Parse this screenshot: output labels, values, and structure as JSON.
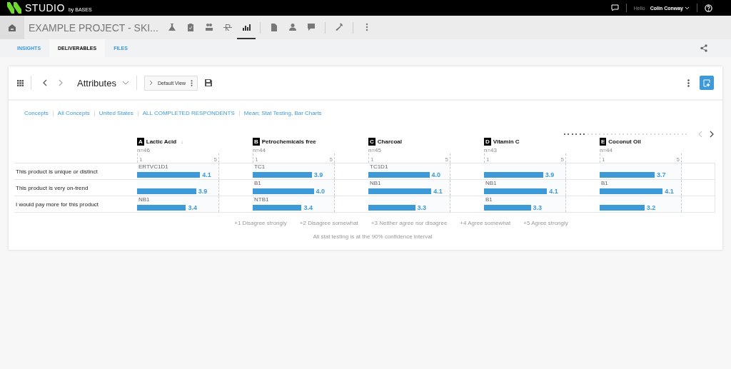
{
  "top_bar": {
    "brand": "STUDIO",
    "brand_suffix": "by BASES",
    "greeting": "Hello",
    "user": "Colin Conway"
  },
  "project": {
    "title": "EXAMPLE PROJECT - SKI...",
    "nav_groups": [
      {
        "icons": [
          {
            "kind": "lab",
            "selected": false
          },
          {
            "kind": "clipboard",
            "selected": false
          },
          {
            "kind": "people",
            "selected": false
          },
          {
            "kind": "r",
            "selected": false
          },
          {
            "kind": "chart",
            "selected": true
          }
        ]
      },
      {
        "icons": [
          {
            "kind": "document",
            "selected": false
          },
          {
            "kind": "person",
            "selected": false
          },
          {
            "kind": "comment",
            "selected": false
          }
        ]
      },
      {
        "icons": [
          {
            "kind": "wrench",
            "selected": false
          }
        ]
      },
      {
        "icons": [
          {
            "kind": "kebab",
            "selected": false
          }
        ]
      }
    ]
  },
  "tabs": [
    {
      "label": "INSIGHTS",
      "selected": false
    },
    {
      "label": "DELIVERABLES",
      "selected": true
    },
    {
      "label": "FILES",
      "selected": false
    }
  ],
  "toolbar": {
    "title": "Attributes",
    "view": "Default View"
  },
  "filters": [
    "Concepts",
    "All Concepts",
    "United States",
    "ALL COMPLETED RESPONDENTS",
    "Mean; Stat Testing, Bar Charts"
  ],
  "pager": [
    {
      "selected": true
    },
    {
      "selected": true
    },
    {
      "selected": true
    },
    {
      "selected": true
    },
    {
      "selected": true
    },
    {
      "selected": true
    },
    {
      "selected": false
    },
    {
      "selected": false
    },
    {
      "selected": false
    },
    {
      "selected": false
    },
    {
      "selected": false
    },
    {
      "selected": false
    },
    {
      "selected": false
    },
    {
      "selected": false
    },
    {
      "selected": false
    },
    {
      "selected": false
    },
    {
      "selected": false
    },
    {
      "selected": false
    },
    {
      "selected": false
    },
    {
      "selected": false
    },
    {
      "selected": false
    },
    {
      "selected": false
    },
    {
      "selected": false
    },
    {
      "selected": false
    },
    {
      "selected": false
    },
    {
      "selected": false
    },
    {
      "selected": false
    },
    {
      "selected": false
    },
    {
      "selected": false
    },
    {
      "selected": false
    },
    {
      "selected": false
    },
    {
      "selected": false
    }
  ],
  "columns": [
    {
      "letter": "A",
      "name": "Lactic Acid",
      "sort": "↓",
      "n": "n=46",
      "scale_min": "1",
      "scale_max": "5"
    },
    {
      "letter": "B",
      "name": "Petrochemicals free",
      "n": "n=44",
      "scale_min": "1",
      "scale_max": "5"
    },
    {
      "letter": "C",
      "name": "Charcoal",
      "n": "n=45",
      "scale_min": "1",
      "scale_max": "5"
    },
    {
      "letter": "D",
      "name": "Vitamin C",
      "n": "n=43",
      "scale_min": "1",
      "scale_max": "5"
    },
    {
      "letter": "E",
      "name": "Coconut Oil",
      "n": "n=44",
      "scale_min": "1",
      "scale_max": "5"
    }
  ],
  "rows": [
    {
      "label": "This product is unique or distinct",
      "cells": [
        {
          "tag": "ERTVC1D1",
          "level": 0.775,
          "reading": "4.1"
        },
        {
          "tag": "TC1",
          "level": 0.725,
          "reading": "3.9"
        },
        {
          "tag": "TC1D1",
          "level": 0.75,
          "reading": "4.0"
        },
        {
          "level": 0.725,
          "reading": "3.9"
        },
        {
          "level": 0.675,
          "reading": "3.7"
        }
      ]
    },
    {
      "label": "This product is very on-trend",
      "cells": [
        {
          "level": 0.725,
          "reading": "3.9"
        },
        {
          "tag": "B1",
          "level": 0.75,
          "reading": "4.0"
        },
        {
          "tag": "NB1",
          "level": 0.775,
          "reading": "4.1"
        },
        {
          "tag": "NB1",
          "level": 0.775,
          "reading": "4.1"
        },
        {
          "tag": "B1",
          "level": 0.775,
          "reading": "4.1"
        }
      ]
    },
    {
      "label": "I would pay more for this product",
      "cells": [
        {
          "tag": "NB1",
          "level": 0.6,
          "reading": "3.4"
        },
        {
          "tag": "NTB1",
          "level": 0.6,
          "reading": "3.4"
        },
        {
          "level": 0.575,
          "reading": "3.3"
        },
        {
          "tag": "B1",
          "level": 0.575,
          "reading": "3.3"
        },
        {
          "level": 0.55,
          "reading": "3.2"
        }
      ]
    }
  ],
  "legend": [
    "+1 Disagree strongly",
    "+2 Disagree somewhat",
    "+3 Neither agree nor disagree",
    "+4 Agree somewhat",
    "+5 Agree strongly"
  ],
  "footnote": "All stat testing is at the 90% confidence interval"
}
